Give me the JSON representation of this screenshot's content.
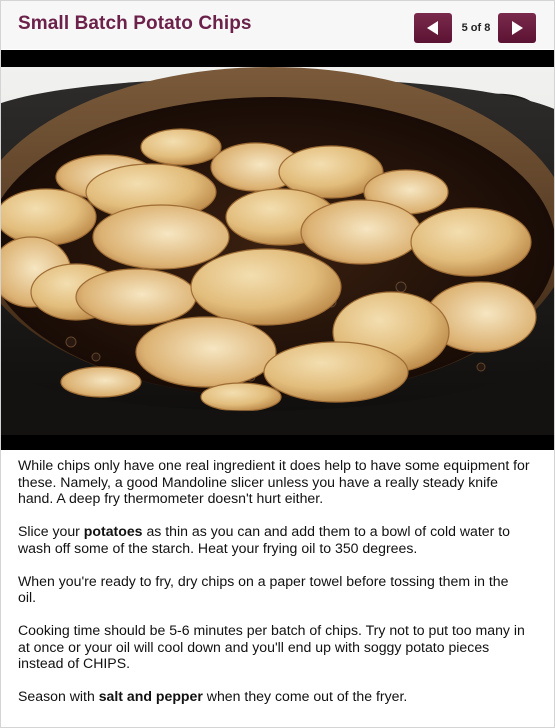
{
  "slideshow": {
    "title": "Small Batch Potato Chips",
    "counter": "5 of 8",
    "prev_icon": "left-triangle-icon",
    "next_icon": "right-triangle-icon",
    "accent_color": "#6b2149",
    "button_color": "#6a1d40"
  },
  "photo": {
    "subject": "potato slices frying in oil in a black cast iron pot"
  },
  "body": {
    "p1": "While chips only have one real ingredient it does help to have some equipment for these. Namely, a good Mandoline slicer unless you have a really steady knife hand. A deep fry thermometer doesn't hurt either.",
    "p2_before": "Slice your ",
    "p2_bold": "potatoes",
    "p2_after": " as thin as you can and add them to a bowl of cold water to wash off some of the starch. Heat your frying oil to 350 degrees.",
    "p3": "When you're ready to fry, dry chips on a paper towel before tossing them in the oil.",
    "p4": "Cooking time should be 5-6 minutes per batch of chips. Try not to put too many in at once or your oil will cool down and you'll end up with soggy potato pieces instead of CHIPS.",
    "p5_before": "Season with ",
    "p5_bold": "salt and pepper",
    "p5_after": " when they come out of the fryer."
  }
}
